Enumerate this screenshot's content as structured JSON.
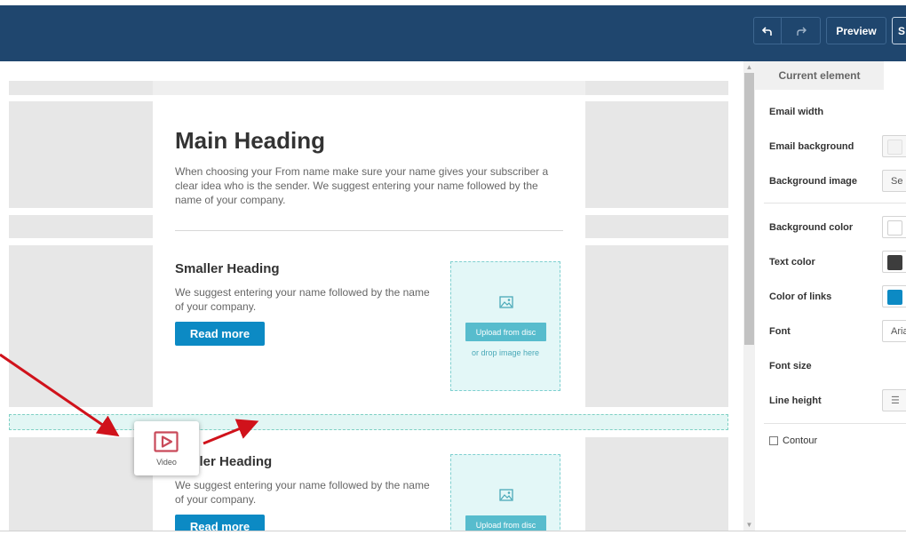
{
  "toolbar": {
    "undo_icon": "undo-icon",
    "redo_icon": "redo-icon",
    "preview_label": "Preview",
    "save_label_partial": "S"
  },
  "email": {
    "main_heading": "Main Heading",
    "main_paragraph": "When choosing your From name make sure your name gives your subscriber a clear idea who is the sender. We suggest entering your name followed by the name of your company.",
    "blocks": [
      {
        "heading": "Smaller Heading",
        "text": "We suggest entering your name followed by the name of your company.",
        "button": "Read more",
        "upload_label": "Upload from disc",
        "drop_text": "or drop image here"
      },
      {
        "heading": "Smaller Heading",
        "text": "We suggest entering your name followed by the name of your company.",
        "button": "Read more",
        "upload_label": "Upload from disc"
      }
    ]
  },
  "drag": {
    "tile_label": "Video",
    "tile_icon": "video-play-icon",
    "heading_partial": "aller Heading"
  },
  "panel": {
    "tab": "Current element",
    "labels": {
      "email_width": "Email width",
      "email_background": "Email background",
      "background_image": "Background image",
      "background_color": "Background color",
      "text_color": "Text color",
      "color_of_links": "Color of links",
      "font": "Font",
      "font_size": "Font size",
      "line_height": "Line height",
      "contour": "Contour"
    },
    "values": {
      "background_image_btn": "Se",
      "font_value": "Aria"
    },
    "colors": {
      "email_background": "#f3f3f3",
      "background_color": "#ffffff",
      "text_color": "#3d3d3d",
      "color_of_links": "#0c8ac4"
    }
  },
  "colors": {
    "topbar": "#1f466e",
    "accent": "#0c8ac4",
    "arrow": "#d0121b",
    "video_icon": "#c94a5a"
  }
}
